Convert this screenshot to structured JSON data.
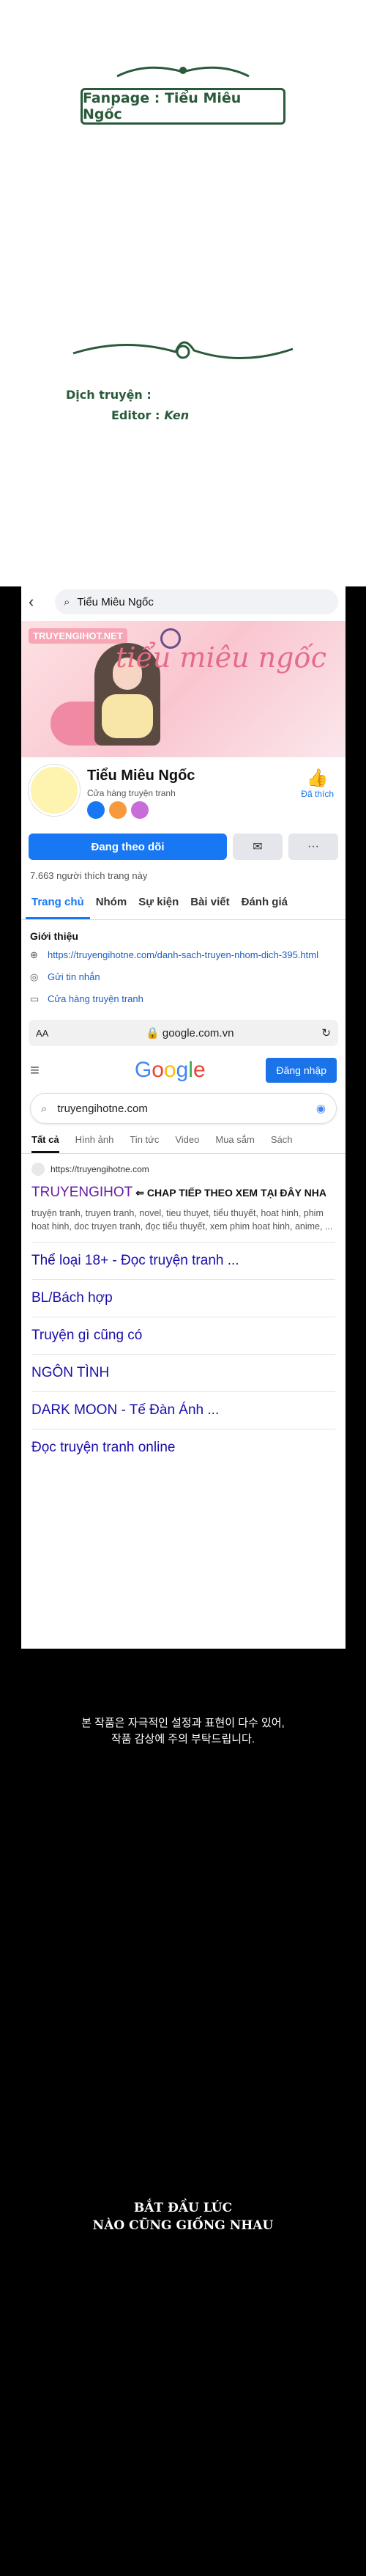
{
  "header": {
    "fanpage_label": "Fanpage : Tiểu Miêu Ngốc",
    "translator_label": "Dịch truyện :",
    "editor_label": "Editor :",
    "editor_value": "Ken"
  },
  "facebook": {
    "search_text": "Tiểu Miêu Ngốc",
    "cover_watermark": "TRUYENGIHOT.NET",
    "cover_script": "tiểu miêu ngốc",
    "page_name": "Tiểu Miêu Ngốc",
    "page_category": "Cửa hàng truyện tranh",
    "like_label": "Đã thích",
    "follow_label": "Đang theo dõi",
    "more_label": "···",
    "likes_count": "7.663 người thích trang này",
    "tabs": [
      "Trang chủ",
      "Nhóm",
      "Sự kiện",
      "Bài viết",
      "Đánh giá"
    ],
    "intro_title": "Giới thiệu",
    "intro_link": "https://truyengihotne.com/danh-sach-truyen-nhom-dich-395.html",
    "intro_message": "Gửi tin nhắn",
    "intro_shop": "Cửa hàng truyện tranh"
  },
  "browser": {
    "aa": "AA",
    "url": "google.com.vn",
    "reload_icon": "reload-icon"
  },
  "google": {
    "logo": [
      "G",
      "o",
      "o",
      "g",
      "l",
      "e"
    ],
    "signin_label": "Đăng nhập",
    "search_value": "truyengihotne.com",
    "tabs": [
      "Tất cả",
      "Hình ảnh",
      "Tin tức",
      "Video",
      "Mua sắm",
      "Sách"
    ],
    "result_url": "https://truyengihotne.com",
    "result_title": "TRUYENGIHOT",
    "result_cta": "⇐ CHAP TIẾP THEO XEM TẠI ĐÂY NHA",
    "result_snippet": "truyện tranh, truyen tranh, novel, tieu thuyet, tiểu thuyết, hoat hinh, phim hoat hinh, doc truyen tranh, đọc tiểu thuyết, xem phim hoat hinh, anime, ...",
    "sitelinks": [
      "Thể loại 18+ - Đọc truyện tranh ...",
      "BL/Bách hợp",
      "Truyện gì cũng có",
      "NGÔN TÌNH",
      "DARK MOON - Tế Đàn Ánh ...",
      "Đọc truyện tranh online"
    ]
  },
  "footer": {
    "notice_line1": "본 작품은 자극적인 설정과 표현이 다수 있어,",
    "notice_line2": "작품 감상에 주의 부탁드립니다.",
    "tagline_line1": "BẮT ĐẦU LÚC",
    "tagline_line2": "NÀO CŨNG GIỐNG NHAU"
  },
  "colors": {
    "accent_green": "#2a5a3a",
    "facebook_blue": "#1877f2",
    "google_link": "#1a0dab",
    "visited_purple": "#681da8"
  }
}
